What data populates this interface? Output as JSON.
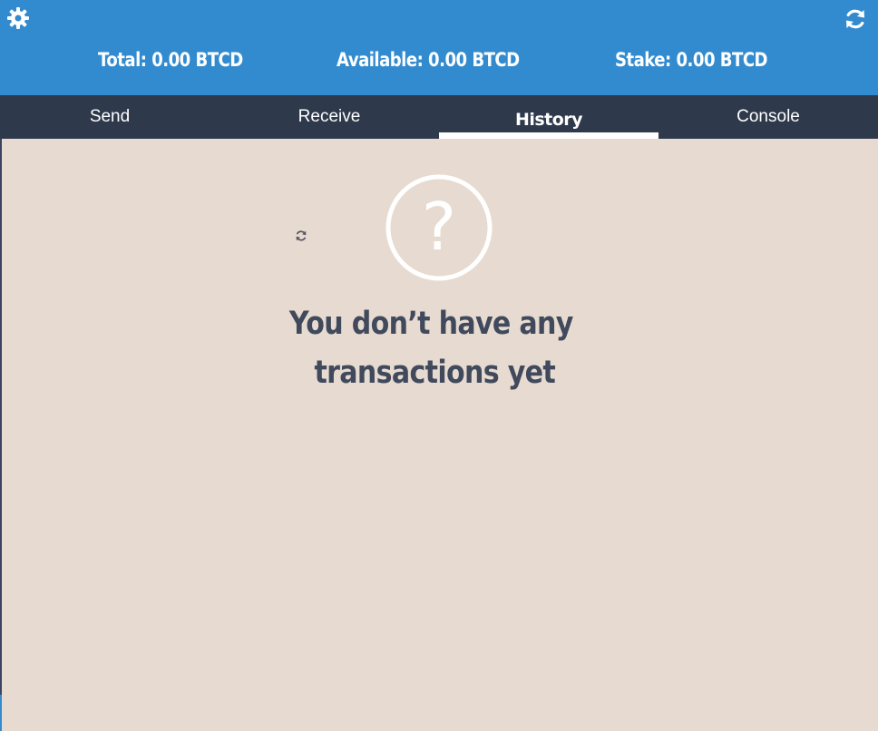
{
  "header": {
    "settings_icon": "gear-icon",
    "refresh_icon": "refresh-icon",
    "total": "Total: 0.00 BTCD",
    "available": "Available: 0.00 BTCD",
    "stake": "Stake: 0.00 BTCD",
    "background_color": "#338bcf"
  },
  "tabs": [
    {
      "label": "Send",
      "active": false
    },
    {
      "label": "Receive",
      "active": false
    },
    {
      "label": "History",
      "active": true
    },
    {
      "label": "Console",
      "active": false
    }
  ],
  "history": {
    "empty_icon": "question-circle-icon",
    "spinner_icon": "refresh-icon",
    "empty_line1": "You don’t have any",
    "empty_line2": "transactions yet"
  },
  "colors": {
    "tab_bar": "#2e394c",
    "content_background": "#e7dbd1",
    "message_text": "#414a5c"
  }
}
